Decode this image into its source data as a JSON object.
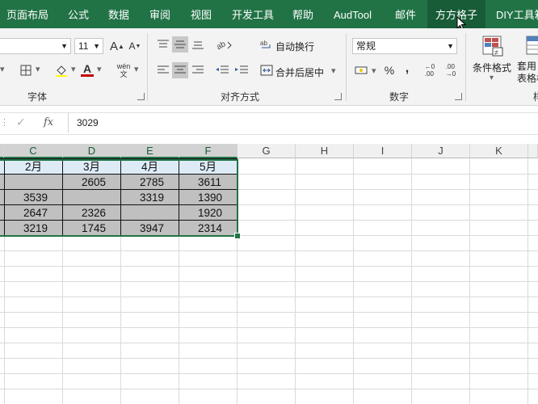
{
  "ribbon_tabs": [
    {
      "label": "页面布局"
    },
    {
      "label": "公式"
    },
    {
      "label": "数据"
    },
    {
      "label": "审阅"
    },
    {
      "label": "视图"
    },
    {
      "label": "开发工具"
    },
    {
      "label": "帮助"
    },
    {
      "label": "AudTool"
    },
    {
      "label": "邮件"
    },
    {
      "label": "方方格子"
    },
    {
      "label": "DIY工具箱"
    }
  ],
  "active_tab": "方方格子",
  "font_group": {
    "size_value": "11",
    "grow_font_label": "A",
    "shrink_font_label": "A",
    "font_color_label": "A",
    "font_color": "#c00000",
    "phonetic_label": "wén\n文",
    "group_label": "字体"
  },
  "align_group": {
    "wrap_text_label": "自动换行",
    "merge_center_label": "合并后居中",
    "group_label": "对齐方式"
  },
  "number_group": {
    "format_value": "常规",
    "percent_label": "%",
    "comma_label": ",",
    "increase_decimal_label": "←0\n.00",
    "decrease_decimal_label": ".00\n→0",
    "group_label": "数字"
  },
  "styles_group": {
    "conditional_format_label": "条件格式",
    "table_format_label": "套用\n表格格",
    "group_label": "样"
  },
  "formula_bar": {
    "fx_label": "fx",
    "value": "3029"
  },
  "columns": [
    "C",
    "D",
    "E",
    "F",
    "G",
    "H",
    "I",
    "J",
    "K"
  ],
  "selected_columns": [
    "C",
    "D",
    "E",
    "F"
  ],
  "table": {
    "headers": [
      "2月",
      "3月",
      "4月",
      "5月"
    ],
    "rows": [
      [
        "",
        "2605",
        "2785",
        "3611"
      ],
      [
        "3539",
        "",
        "3319",
        "1390"
      ],
      [
        "2647",
        "2326",
        "",
        "1920"
      ],
      [
        "3219",
        "1745",
        "3947",
        "2314"
      ]
    ]
  },
  "colors": {
    "tab_bar": "#217346",
    "active_tab": "#185c37",
    "header_fill": "#ddebf7",
    "data_fill": "#c0c0c0",
    "selection": "#217346"
  }
}
